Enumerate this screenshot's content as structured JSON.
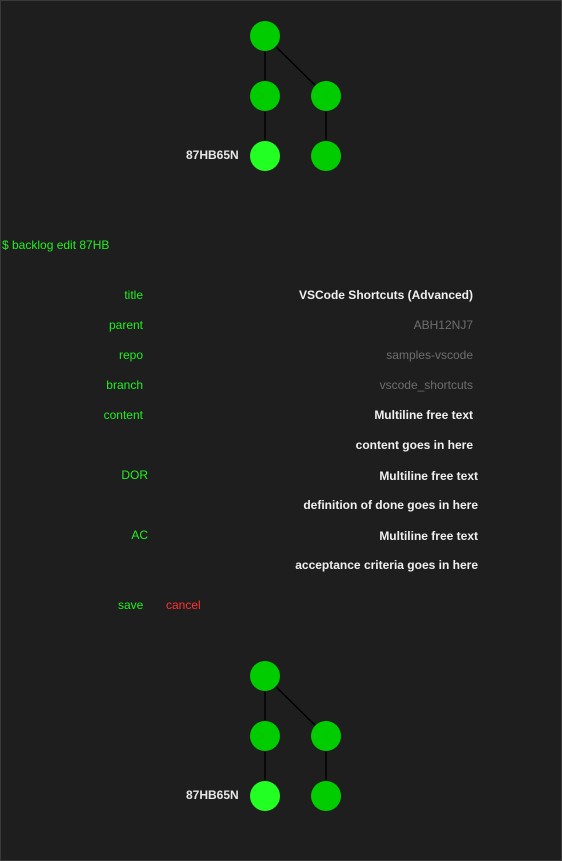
{
  "graph_top": {
    "highlight_label": "87HB65N",
    "node_color": "#00cc00",
    "highlight_color": "#22ff22"
  },
  "command": "$ backlog edit 87HB",
  "form": {
    "title": {
      "label": "title",
      "value": "VSCode Shortcuts (Advanced)"
    },
    "parent": {
      "label": "parent",
      "placeholder": "ABH12NJ7"
    },
    "repo": {
      "label": "repo",
      "placeholder": "samples-vscode"
    },
    "branch": {
      "label": "branch",
      "placeholder": "vscode_shortcuts"
    },
    "content": {
      "label": "content",
      "line1": "Multiline free text",
      "line2": "content goes in here"
    },
    "dor": {
      "label": "DOR",
      "line1": "Multiline free text",
      "line2": "definition of done goes in here"
    },
    "ac": {
      "label": "AC",
      "line1": "Multiline free text",
      "line2": "acceptance criteria goes in here"
    }
  },
  "actions": {
    "save": "save",
    "cancel": "cancel"
  },
  "graph_bottom": {
    "highlight_label": "87HB65N"
  }
}
